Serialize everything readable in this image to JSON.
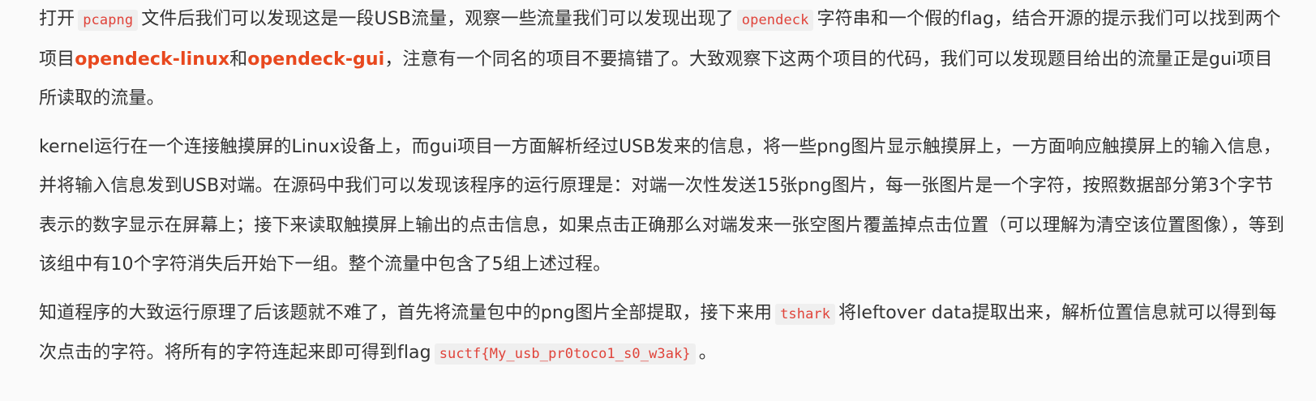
{
  "paragraphs": {
    "p1": {
      "t1": "打开",
      "code1": "pcapng",
      "t2": "文件后我们可以发现这是一段USB流量，观察一些流量我们可以发现出现了",
      "code2": "opendeck",
      "t3": "字符串和一个假的flag，结合开源的提示我们可以找到两个项目",
      "link1": "opendeck-linux",
      "t4": "和",
      "link2": "opendeck-gui",
      "t5": "，注意有一个同名的项目不要搞错了。大致观察下这两个项目的代码，我们可以发现题目给出的流量正是gui项目所读取的流量。"
    },
    "p2": {
      "text": "kernel运行在一个连接触摸屏的Linux设备上，而gui项目一方面解析经过USB发来的信息，将一些png图片显示触摸屏上，一方面响应触摸屏上的输入信息，并将输入信息发到USB对端。在源码中我们可以发现该程序的运行原理是：对端一次性发送15张png图片，每一张图片是一个字符，按照数据部分第3个字节表示的数字显示在屏幕上；接下来读取触摸屏上输出的点击信息，如果点击正确那么对端发来一张空图片覆盖掉点击位置（可以理解为清空该位置图像），等到该组中有10个字符消失后开始下一组。整个流量中包含了5组上述过程。"
    },
    "p3": {
      "t1": "知道程序的大致运行原理了后该题就不难了，首先将流量包中的png图片全部提取，接下来用",
      "code1": "tshark",
      "t2": "将leftover data提取出来，解析位置信息就可以得到每次点击的字符。将所有的字符连起来即可得到flag",
      "code2": "suctf{My_usb_pr0toco1_s0_w3ak}",
      "t3": "。"
    }
  }
}
